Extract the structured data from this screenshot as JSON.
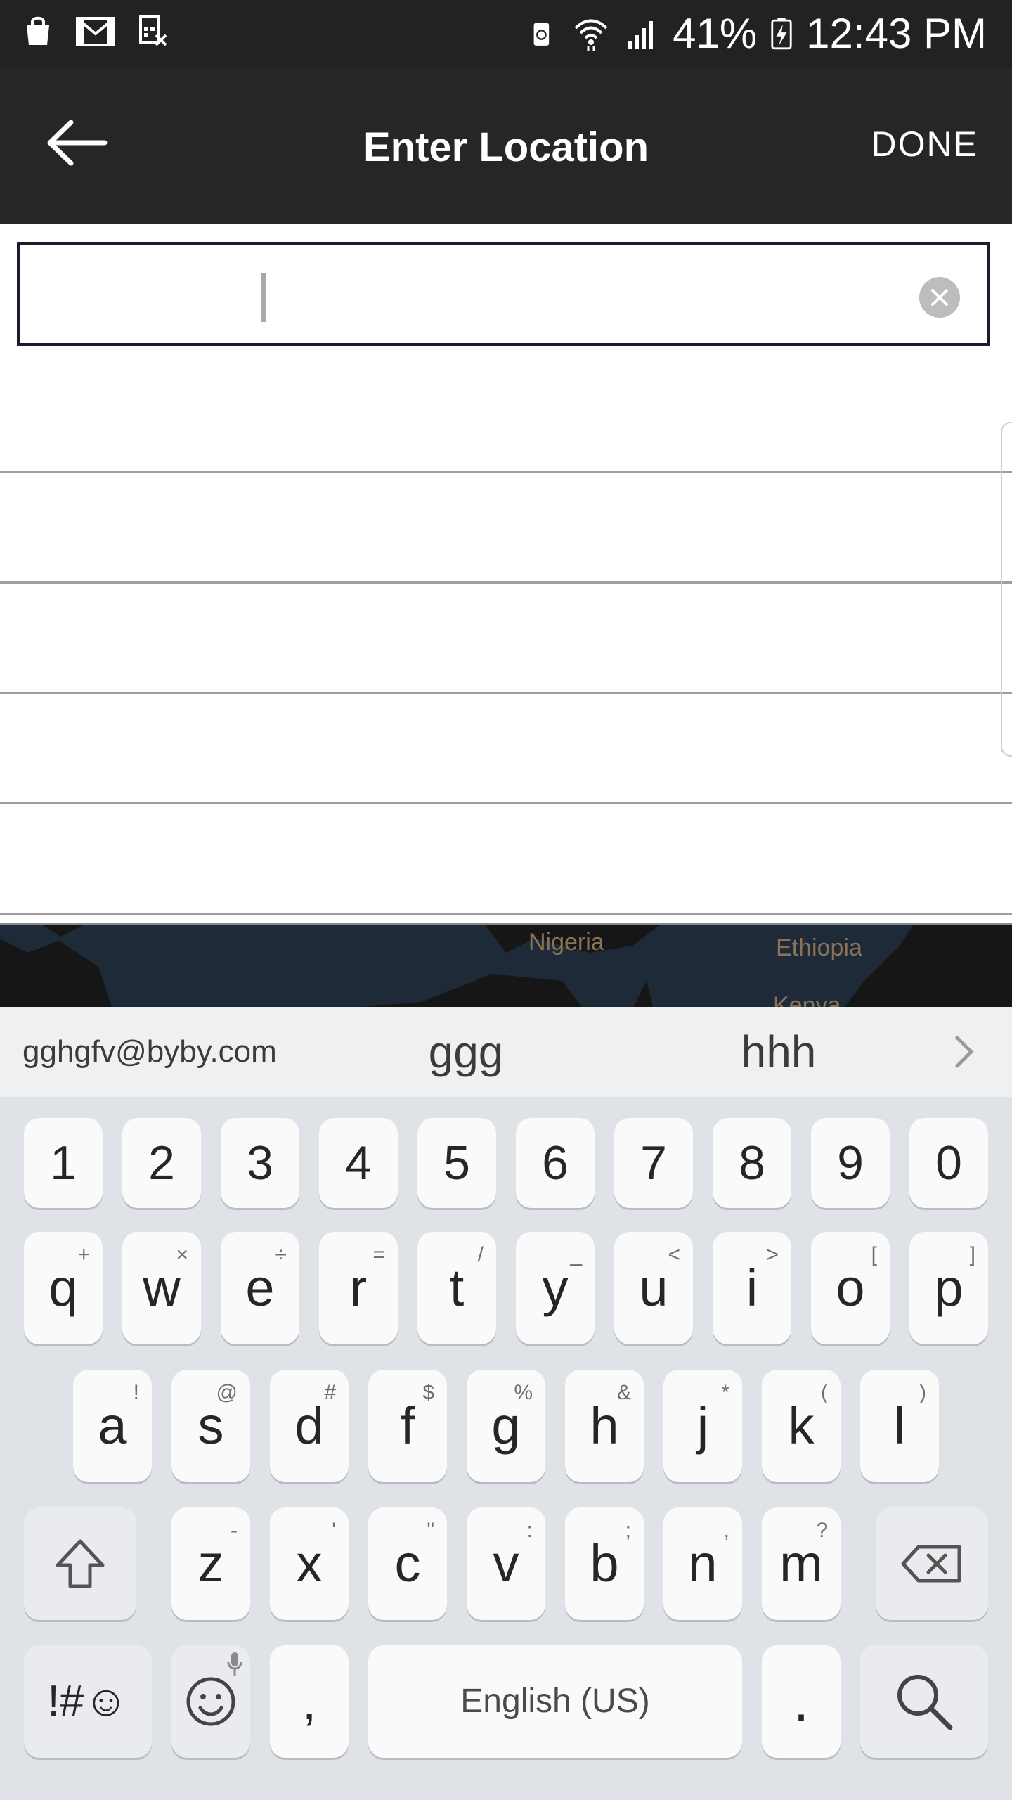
{
  "status_bar": {
    "battery_percent": "41%",
    "time": "12:43 PM",
    "icons_left": [
      "shopping-bag-icon",
      "gmail-icon",
      "sim-blocked-icon"
    ],
    "icons_right": [
      "battery-saver-icon",
      "wifi-icon",
      "signal-icon",
      "battery-charging-icon"
    ]
  },
  "app_bar": {
    "title": "Enter Location",
    "done_label": "DONE",
    "back_icon": "arrow-left-icon"
  },
  "search": {
    "value": "",
    "placeholder": "",
    "clear_icon": "clear-circle-icon"
  },
  "suggestions_list": {
    "rows": [
      "",
      "",
      "",
      "",
      ""
    ]
  },
  "map": {
    "labels": [
      "Nigeria",
      "Ethiopia",
      "Kenya"
    ]
  },
  "keyboard": {
    "suggestions": [
      "gghgfv@byby.com",
      "ggg",
      "hhh"
    ],
    "number_row": [
      "1",
      "2",
      "3",
      "4",
      "5",
      "6",
      "7",
      "8",
      "9",
      "0"
    ],
    "row1": [
      {
        "k": "q",
        "h": "+"
      },
      {
        "k": "w",
        "h": "×"
      },
      {
        "k": "e",
        "h": "÷"
      },
      {
        "k": "r",
        "h": "="
      },
      {
        "k": "t",
        "h": "/"
      },
      {
        "k": "y",
        "h": "_"
      },
      {
        "k": "u",
        "h": "<"
      },
      {
        "k": "i",
        "h": ">"
      },
      {
        "k": "o",
        "h": "["
      },
      {
        "k": "p",
        "h": "]"
      }
    ],
    "row2": [
      {
        "k": "a",
        "h": "!"
      },
      {
        "k": "s",
        "h": "@"
      },
      {
        "k": "d",
        "h": "#"
      },
      {
        "k": "f",
        "h": "$"
      },
      {
        "k": "g",
        "h": "%"
      },
      {
        "k": "h",
        "h": "&"
      },
      {
        "k": "j",
        "h": "*"
      },
      {
        "k": "k",
        "h": "("
      },
      {
        "k": "l",
        "h": ")"
      }
    ],
    "row3": [
      {
        "k": "z",
        "h": "-"
      },
      {
        "k": "x",
        "h": "'"
      },
      {
        "k": "c",
        "h": "\""
      },
      {
        "k": "v",
        "h": ":"
      },
      {
        "k": "b",
        "h": ";"
      },
      {
        "k": "n",
        "h": ","
      },
      {
        "k": "m",
        "h": "?"
      }
    ],
    "symbols_label": "!#☺",
    "comma_label": ",",
    "space_label": "English (US)",
    "period_label": ".",
    "shift_icon": "shift-arrow-icon",
    "backspace_icon": "backspace-icon",
    "emoji_icon": "emoji-icon",
    "mic_icon": "microphone-icon",
    "search_icon": "search-icon"
  }
}
